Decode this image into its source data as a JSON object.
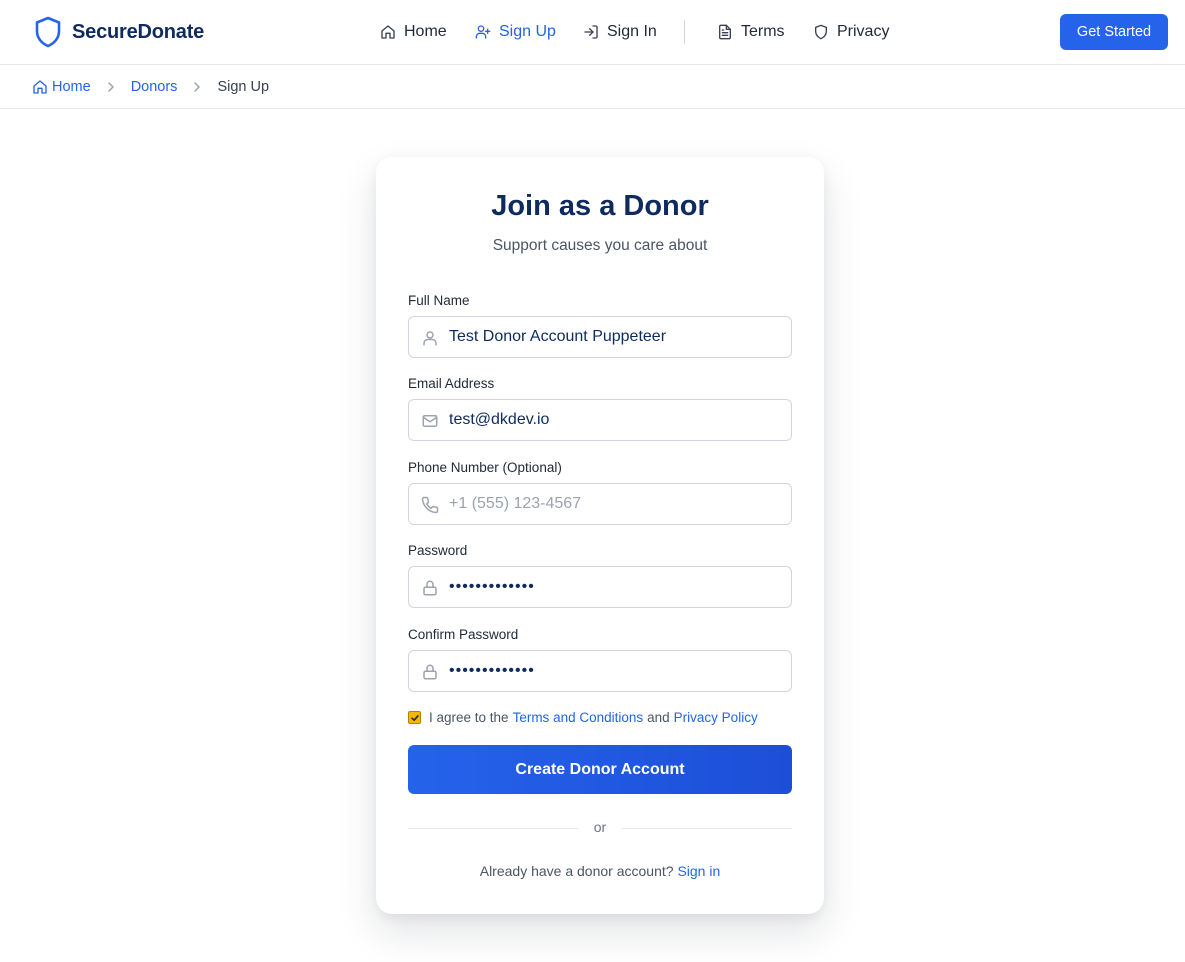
{
  "header": {
    "brand": "SecureDonate",
    "nav": [
      {
        "label": "Home",
        "icon": "home-icon"
      },
      {
        "label": "Sign Up",
        "icon": "user-plus-icon",
        "active": true
      },
      {
        "label": "Sign In",
        "icon": "log-in-icon"
      },
      {
        "label": "Terms",
        "icon": "document-icon"
      },
      {
        "label": "Privacy",
        "icon": "shield-icon"
      }
    ],
    "cta": "Get Started"
  },
  "breadcrumb": {
    "home": "Home",
    "donors": "Donors",
    "current": "Sign Up"
  },
  "form": {
    "title": "Join as a Donor",
    "subtitle": "Support causes you care about",
    "full_name": {
      "label": "Full Name",
      "value": "Test Donor Account Puppeteer"
    },
    "email": {
      "label": "Email Address",
      "value": "test@dkdev.io"
    },
    "phone": {
      "label": "Phone Number (Optional)",
      "value": "",
      "placeholder": "+1 (555) 123-4567"
    },
    "password": {
      "label": "Password",
      "value": "•••••••••••••"
    },
    "confirm_password": {
      "label": "Confirm Password",
      "value": "•••••••••••••"
    },
    "agree": {
      "prefix": "I agree to the",
      "terms_link": "Terms and Conditions",
      "middle": "and",
      "privacy_link": "Privacy Policy",
      "checked": true
    },
    "submit": "Create Donor Account",
    "divider": "or",
    "signin_prompt": "Already have a donor account?",
    "signin_link": "Sign in"
  },
  "colors": {
    "accent": "#2563eb",
    "title": "#0f2a5f",
    "checkbox": "#f5b700"
  }
}
